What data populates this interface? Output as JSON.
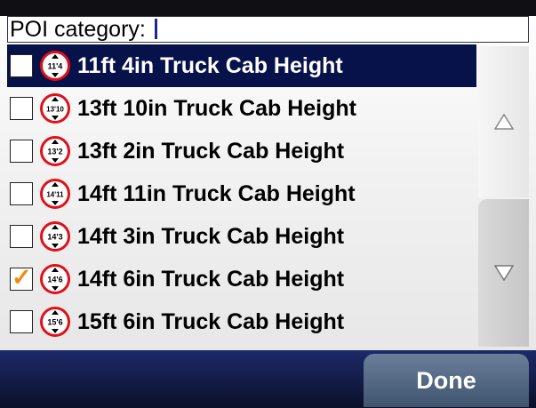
{
  "search": {
    "label": "POI category: "
  },
  "items": [
    {
      "sign": "11'4",
      "label": "11ft 4in Truck Cab Height",
      "checked": false,
      "selected": true
    },
    {
      "sign": "13'10",
      "label": "13ft 10in Truck Cab Height",
      "checked": false,
      "selected": false
    },
    {
      "sign": "13'2",
      "label": "13ft 2in Truck Cab Height",
      "checked": false,
      "selected": false
    },
    {
      "sign": "14'11",
      "label": "14ft 11in Truck Cab Height",
      "checked": false,
      "selected": false
    },
    {
      "sign": "14'3",
      "label": "14ft 3in Truck Cab Height",
      "checked": false,
      "selected": false
    },
    {
      "sign": "14'6",
      "label": "14ft 6in Truck Cab Height",
      "checked": true,
      "selected": false
    },
    {
      "sign": "15'6",
      "label": "15ft 6in Truck Cab Height",
      "checked": false,
      "selected": false
    }
  ],
  "scroll": {
    "up_icon": "triangle-up",
    "down_icon": "triangle-down"
  },
  "done_label": "Done",
  "colors": {
    "selection": "#08124a",
    "checkmark": "#f08a10",
    "sign_ring": "#e0101a",
    "footer": "#0a1028"
  }
}
